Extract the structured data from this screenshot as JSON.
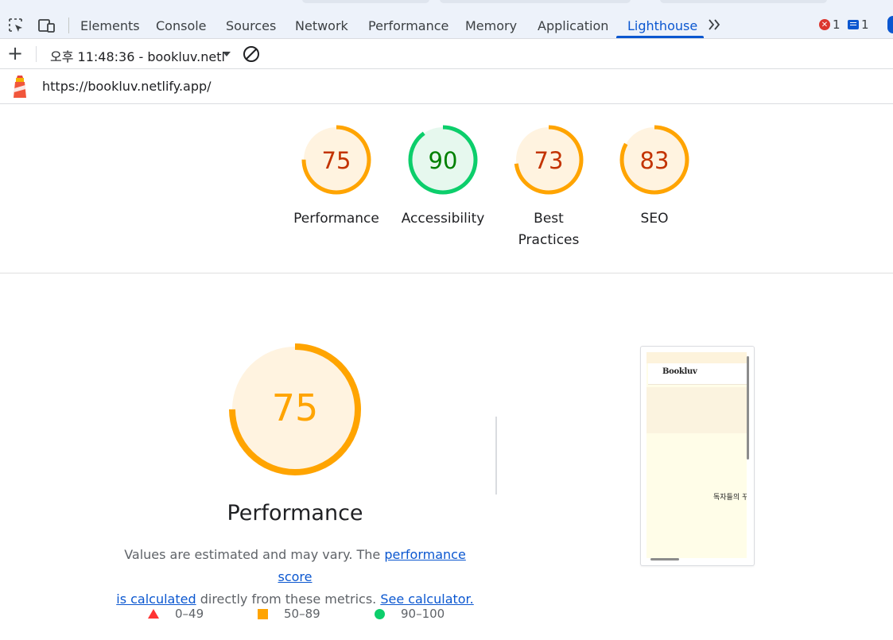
{
  "devtools": {
    "tabs": [
      "Elements",
      "Console",
      "Sources",
      "Network",
      "Performance",
      "Memory",
      "Application",
      "Lighthouse"
    ],
    "active_tab": "Lighthouse",
    "error_count": "1",
    "message_count": "1"
  },
  "report_bar": {
    "selected_report": "오후 11:48:36 - bookluv.netl"
  },
  "url_bar": {
    "url": "https://bookluv.netlify.app/"
  },
  "scores": [
    {
      "label_1": "Performance",
      "label_2": "",
      "value": "75",
      "score": 75,
      "status": "average"
    },
    {
      "label_1": "Accessibility",
      "label_2": "",
      "value": "90",
      "score": 90,
      "status": "pass"
    },
    {
      "label_1": "Best",
      "label_2": "Practices",
      "value": "73",
      "score": 73,
      "status": "average"
    },
    {
      "label_1": "SEO",
      "label_2": "",
      "value": "83",
      "score": 83,
      "status": "average"
    }
  ],
  "performance_section": {
    "score_text": "75",
    "score": 75,
    "title": "Performance",
    "desc_prefix": "Values are estimated and may vary. The ",
    "link_score_1": "performance score",
    "link_score_2": "is calculated",
    "desc_middle": " directly from these metrics. ",
    "link_calculator": "See calculator."
  },
  "legend": {
    "fail": "0–49",
    "average": "50–89",
    "pass": "90–100"
  },
  "thumbnail": {
    "brand": "Bookluv",
    "tagline": "독자들의 꾸"
  },
  "colors": {
    "average": "#ffa400",
    "average_text": "#c33300",
    "average_bg": "#fff3e0",
    "pass": "#0cce6b",
    "pass_text": "#008000",
    "pass_bg": "#e6f8ee",
    "fail": "#ff3333",
    "link": "#0b57d0"
  }
}
